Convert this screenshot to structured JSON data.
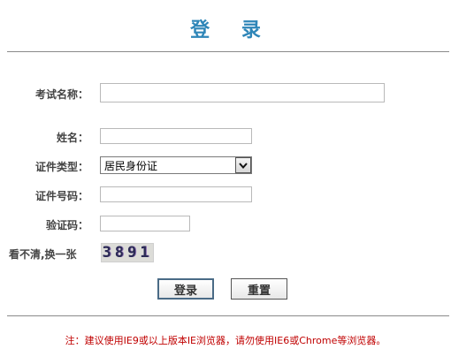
{
  "page": {
    "title": "登  录"
  },
  "form": {
    "exam_name_label": "考试名称：",
    "exam_name_value": "",
    "name_label": "姓名：",
    "name_value": "",
    "id_type_label": "证件类型：",
    "id_type_selected": "居民身份证",
    "id_number_label": "证件号码：",
    "id_number_value": "",
    "captcha_label": "验证码：",
    "captcha_value": "",
    "refresh_captcha_label": "看不清,换一张",
    "captcha_text": "3891"
  },
  "buttons": {
    "login": "登录",
    "reset": "重置"
  },
  "footer": {
    "note": "注：建议使用IE9或以上版本IE浏览器，请勿使用IE6或Chrome等浏览器。"
  },
  "colors": {
    "title": "#2f86b8",
    "note": "#c00000",
    "divider": "#8a8a8a"
  }
}
